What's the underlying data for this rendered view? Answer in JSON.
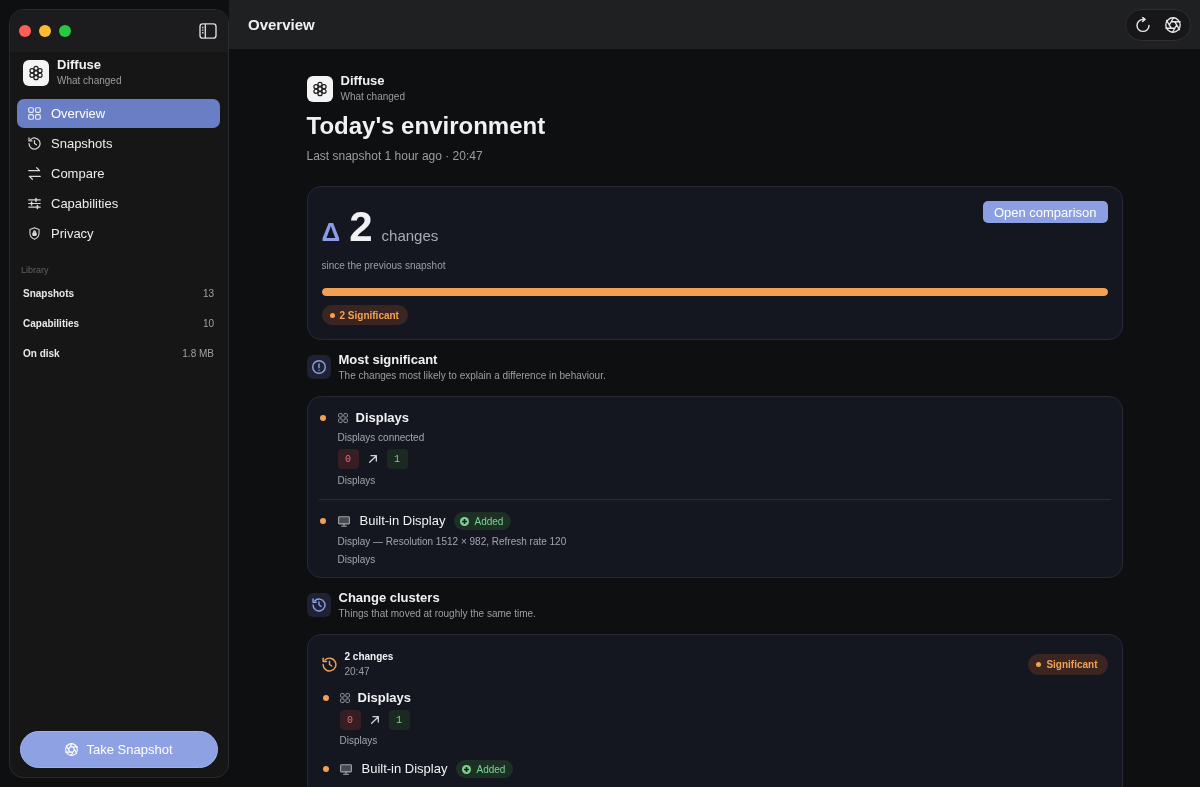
{
  "sidebar": {
    "brand": {
      "name": "Diffuse",
      "tagline": "What changed"
    },
    "nav": [
      {
        "label": "Overview",
        "selected": true
      },
      {
        "label": "Snapshots",
        "selected": false
      },
      {
        "label": "Compare",
        "selected": false
      },
      {
        "label": "Capabilities",
        "selected": false
      },
      {
        "label": "Privacy",
        "selected": false
      }
    ],
    "library": {
      "title": "Library",
      "rows": [
        {
          "label": "Snapshots",
          "value": "13"
        },
        {
          "label": "Capabilities",
          "value": "10"
        },
        {
          "label": "On disk",
          "value": "1.8 MB"
        }
      ]
    },
    "action": "Take Snapshot"
  },
  "header": {
    "title": "Overview"
  },
  "page": {
    "brand": {
      "name": "Diffuse",
      "tagline": "What changed"
    },
    "title": "Today's environment",
    "subtitle": "Last snapshot 1 hour ago · 20:47"
  },
  "summary": {
    "symbol": "Δ",
    "count": "2",
    "unit": "changes",
    "caption": "since the previous snapshot",
    "action": "Open comparison",
    "bar": {
      "level": 1
    },
    "badge": {
      "label": "2 Significant",
      "color": "#f2a154"
    }
  },
  "sections": [
    {
      "kind": "list",
      "title": "Most significant",
      "subtitle": "The changes most likely to explain a difference in behaviour.",
      "items": [
        {
          "kind": "metric",
          "title": "Displays",
          "color": "#f2a154",
          "description": "Displays connected",
          "from": "0",
          "to": "1",
          "category": "Displays"
        },
        {
          "kind": "device",
          "title": "Built-in Display",
          "color": "#f2a154",
          "status": {
            "kind": "added",
            "label": "Added"
          },
          "description": "Display — Resolution 1512 × 982, Refresh rate 120",
          "category": "Displays"
        }
      ]
    },
    {
      "kind": "clusters",
      "title": "Change clusters",
      "subtitle": "Things that moved at roughly the same time.",
      "clusters": [
        {
          "title": "2 changes",
          "time": "20:47",
          "badge": {
            "label": "Significant",
            "color": "#f2a154"
          },
          "items": [
            {
              "kind": "metric",
              "title": "Displays",
              "color": "#f2a154",
              "from": "0",
              "to": "1",
              "category": "Displays"
            },
            {
              "kind": "device",
              "title": "Built-in Display",
              "color": "#f2a154",
              "status": {
                "kind": "added",
                "label": "Added"
              }
            }
          ]
        }
      ]
    }
  ]
}
